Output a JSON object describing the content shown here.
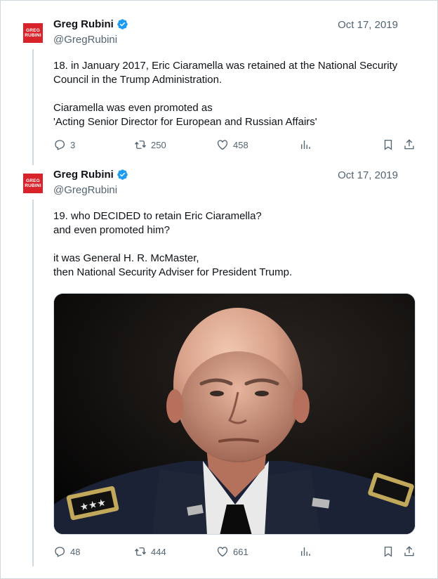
{
  "author": {
    "name": "Greg Rubini",
    "handle": "@GregRubini",
    "avatar_text_top": "GREG",
    "avatar_text_bottom": "RUBINI",
    "avatar_color": "#d8232a",
    "verified_color": "#1d9bf0"
  },
  "tweets": [
    {
      "date": "Oct 17, 2019",
      "text": "18. in January 2017, Eric Ciaramella was retained at the National Security\nCouncil in the Trump Administration.\n\nCiaramella was even promoted as\n'Acting Senior Director for European and Russian Affairs'",
      "replies": "3",
      "retweets": "250",
      "likes": "458"
    },
    {
      "date": "Oct 17, 2019",
      "text": "19. who DECIDED to retain Eric Ciaramella?\nand even promoted  him?\n\nit was General H. R. McMaster,\nthen National Security Adviser for President Trump.",
      "replies": "48",
      "retweets": "444",
      "likes": "661"
    }
  ],
  "icons": {
    "reply": "reply-icon",
    "retweet": "retweet-icon",
    "like": "like-icon",
    "views": "views-icon",
    "bookmark": "bookmark-icon",
    "share": "share-icon",
    "verified": "verified-badge-icon"
  }
}
